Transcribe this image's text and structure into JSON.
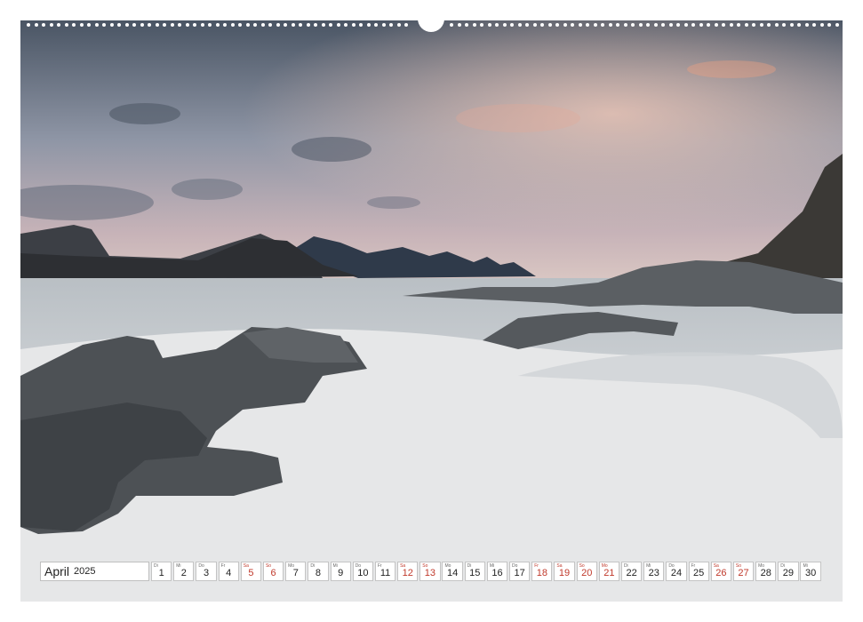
{
  "calendar": {
    "month": "April",
    "year": "2025",
    "weekend_color": "#c0392b",
    "days": [
      {
        "num": "1",
        "wd": "Di"
      },
      {
        "num": "2",
        "wd": "Mi"
      },
      {
        "num": "3",
        "wd": "Do"
      },
      {
        "num": "4",
        "wd": "Fr"
      },
      {
        "num": "5",
        "wd": "Sa",
        "we": true
      },
      {
        "num": "6",
        "wd": "So",
        "we": true
      },
      {
        "num": "7",
        "wd": "Mo"
      },
      {
        "num": "8",
        "wd": "Di"
      },
      {
        "num": "9",
        "wd": "Mi"
      },
      {
        "num": "10",
        "wd": "Do"
      },
      {
        "num": "11",
        "wd": "Fr"
      },
      {
        "num": "12",
        "wd": "Sa",
        "we": true
      },
      {
        "num": "13",
        "wd": "So",
        "we": true
      },
      {
        "num": "14",
        "wd": "Mo"
      },
      {
        "num": "15",
        "wd": "Di"
      },
      {
        "num": "16",
        "wd": "Mi"
      },
      {
        "num": "17",
        "wd": "Do"
      },
      {
        "num": "18",
        "wd": "Fr",
        "we": true
      },
      {
        "num": "19",
        "wd": "Sa",
        "we": true
      },
      {
        "num": "20",
        "wd": "So",
        "we": true
      },
      {
        "num": "21",
        "wd": "Mo",
        "we": true
      },
      {
        "num": "22",
        "wd": "Di"
      },
      {
        "num": "23",
        "wd": "Mi"
      },
      {
        "num": "24",
        "wd": "Do"
      },
      {
        "num": "25",
        "wd": "Fr"
      },
      {
        "num": "26",
        "wd": "Sa",
        "we": true
      },
      {
        "num": "27",
        "wd": "So",
        "we": true
      },
      {
        "num": "28",
        "wd": "Mo"
      },
      {
        "num": "29",
        "wd": "Di"
      },
      {
        "num": "30",
        "wd": "Mi"
      }
    ]
  },
  "photo": {
    "subject": "rocky-beach-seascape-icon",
    "sky_top": "#4a5564",
    "sky_glow": "#e6b8b0",
    "sea": "#cdd2d6",
    "sand": "#e8e9ea",
    "rock": "#4f5357"
  }
}
